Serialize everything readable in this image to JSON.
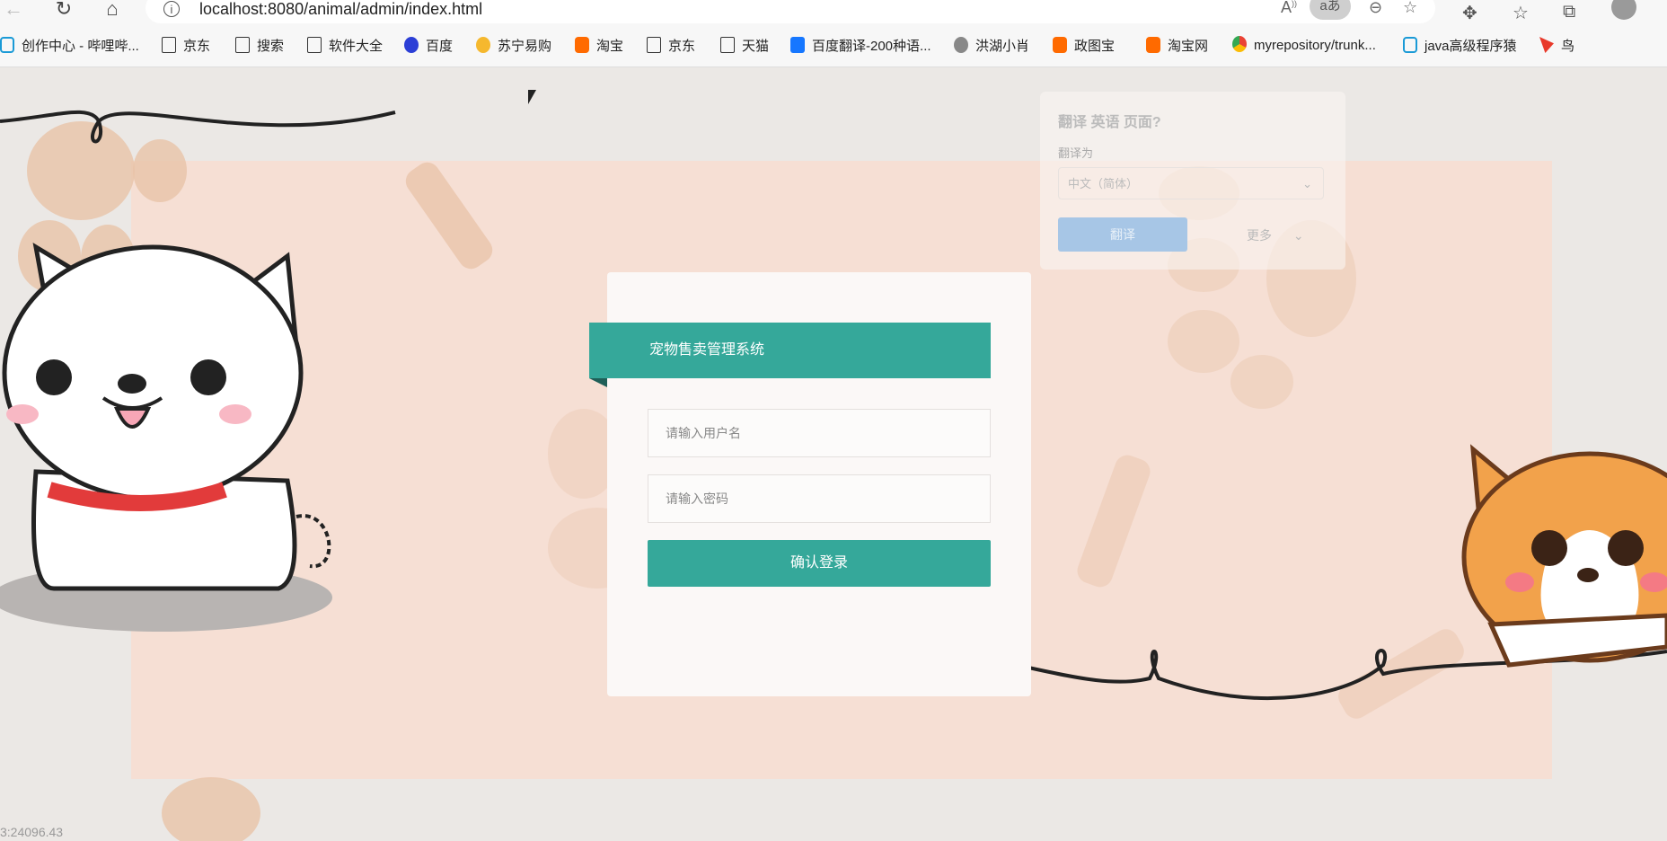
{
  "browser": {
    "url": "localhost:8080/animal/admin/index.html",
    "aa_label": "aあ",
    "bookmarks": [
      {
        "label": "创作中心 - 哔哩哔...",
        "icon": "tv-icon"
      },
      {
        "label": "京东",
        "icon": "file-icon"
      },
      {
        "label": "搜索",
        "icon": "file-icon"
      },
      {
        "label": "软件大全",
        "icon": "file-icon"
      },
      {
        "label": "百度",
        "icon": "paw-icon"
      },
      {
        "label": "苏宁易购",
        "icon": "suning-icon"
      },
      {
        "label": "淘宝",
        "icon": "taobao-icon"
      },
      {
        "label": "京东",
        "icon": "file-icon"
      },
      {
        "label": "天猫",
        "icon": "file-icon"
      },
      {
        "label": "百度翻译-200种语...",
        "icon": "translate-icon"
      },
      {
        "label": "洪湖小肖",
        "icon": "avatar-icon"
      },
      {
        "label": "政图宝",
        "icon": "folder-icon"
      },
      {
        "label": "淘宝网",
        "icon": "taobao-icon"
      },
      {
        "label": "myrepository/trunk...",
        "icon": "chrome-icon"
      },
      {
        "label": "java高级程序猿",
        "icon": "tv-icon"
      },
      {
        "label": "鸟",
        "icon": "bird-icon"
      }
    ]
  },
  "translator": {
    "title": "翻译 英语 页面?",
    "label": "翻译为",
    "language": "中文（简体）",
    "translate_button": "翻译",
    "more": "更多"
  },
  "login": {
    "system_title": "宠物售卖管理系统",
    "username_placeholder": "请输入用户名",
    "password_placeholder": "请输入密码",
    "submit": "确认登录"
  },
  "status": {
    "coord": "3:24096.43"
  },
  "colors": {
    "accent": "#35a89a",
    "background_pink": "#f6dfd4"
  }
}
